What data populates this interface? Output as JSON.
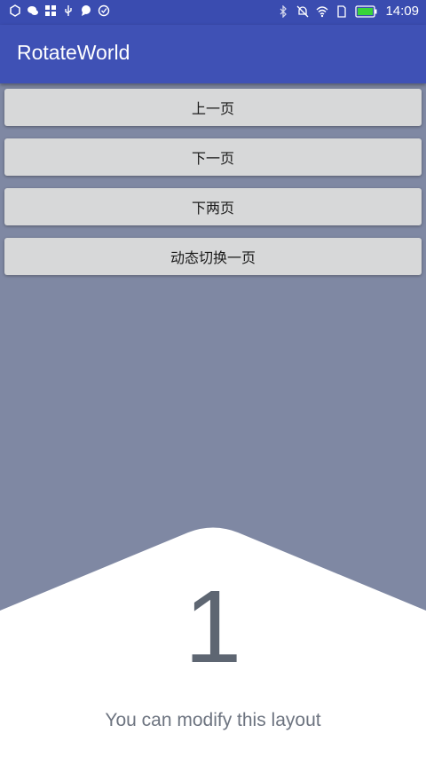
{
  "status_bar": {
    "time": "14:09",
    "left_icons": [
      "app-icon",
      "wechat-icon",
      "grid-icon",
      "usb-icon",
      "chat-icon",
      "check-icon"
    ],
    "right_icons": [
      "bluetooth-icon",
      "mute-icon",
      "wifi-icon",
      "sim-icon",
      "battery-icon"
    ]
  },
  "app_bar": {
    "title": "RotateWorld",
    "color": "#3f51b5"
  },
  "buttons": [
    {
      "label": "上一页"
    },
    {
      "label": "下一页"
    },
    {
      "label": "下两页"
    },
    {
      "label": "动态切换一页"
    }
  ],
  "page": {
    "number": "1",
    "caption": "You can modify this layout",
    "background_color": "#7f88a3"
  }
}
